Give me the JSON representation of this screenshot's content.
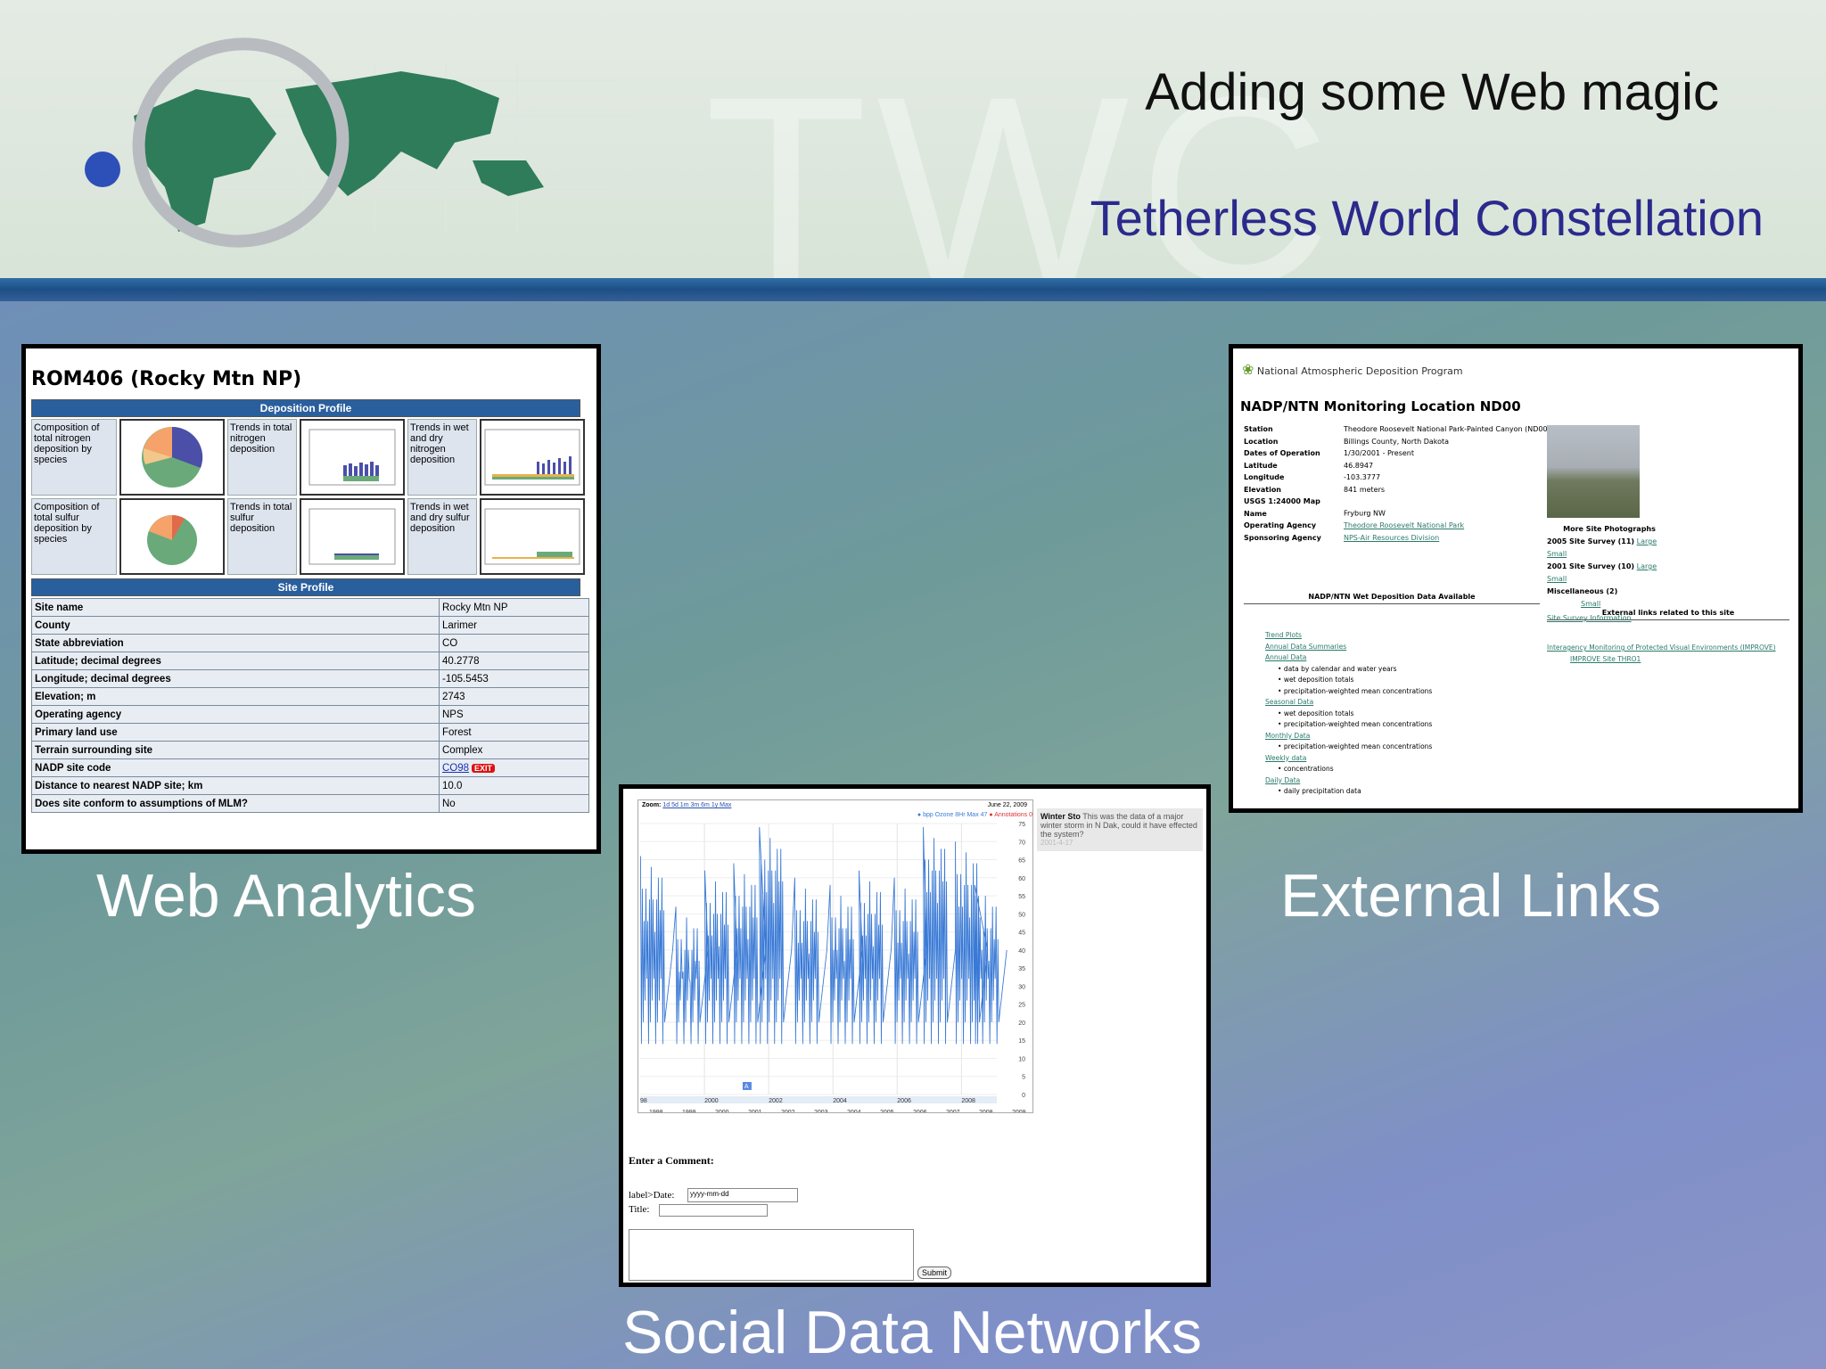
{
  "slide": {
    "title": "Adding some Web magic",
    "subtitle": "Tetherless World Constellation",
    "watermark": "TWC",
    "captions": {
      "web_analytics": "Web Analytics",
      "external_links": "External Links",
      "social_data": "Social Data Networks"
    },
    "colors": {
      "subtitle": "#2b2a8c",
      "header_bar": "#2a5f9e",
      "caption": "#ffffff"
    }
  },
  "web_analytics": {
    "site_title": "ROM406 (Rocky Mtn NP)",
    "deposition_header": "Deposition Profile",
    "dep_rows": [
      [
        "Composition of total nitrogen deposition by species",
        "Trends in total nitrogen deposition",
        "Trends in wet and dry nitrogen deposition"
      ],
      [
        "Composition of total sulfur deposition by species",
        "Trends in total sulfur deposition",
        "Trends in wet and dry sulfur deposition"
      ]
    ],
    "site_header": "Site Profile",
    "profile": [
      [
        "Site name",
        "Rocky Mtn NP"
      ],
      [
        "County",
        "Larimer"
      ],
      [
        "State abbreviation",
        "CO"
      ],
      [
        "Latitude; decimal degrees",
        "40.2778"
      ],
      [
        "Longitude; decimal degrees",
        "-105.5453"
      ],
      [
        "Elevation; m",
        "2743"
      ],
      [
        "Operating agency",
        "NPS"
      ],
      [
        "Primary land use",
        "Forest"
      ],
      [
        "Terrain surrounding site",
        "Complex"
      ],
      [
        "NADP site code",
        "CO98"
      ],
      [
        "Distance to nearest NADP site; km",
        "10.0"
      ],
      [
        "Does site conform to assumptions of MLM?",
        "No"
      ]
    ],
    "exit_badge": "EXIT"
  },
  "external_links": {
    "program": "National Atmospheric Deposition Program",
    "title": "NADP/NTN Monitoring Location ND00",
    "info": [
      [
        "Station",
        "Theodore Roosevelt National Park-Painted Canyon (ND00)"
      ],
      [
        "Location",
        "Billings County, North Dakota"
      ],
      [
        "Dates of Operation",
        "1/30/2001 - Present"
      ],
      [
        "Latitude",
        "46.8947"
      ],
      [
        "Longitude",
        "-103.3777"
      ],
      [
        "Elevation",
        "841 meters"
      ],
      [
        "USGS 1:24000 Map Name",
        "Fryburg NW"
      ],
      [
        "Operating Agency",
        "Theodore Roosevelt National Park"
      ],
      [
        "Sponsoring Agency",
        "NPS-Air Resources Division"
      ]
    ],
    "more_photos": "More Site Photographs",
    "survey_2005": "2005 Site Survey (11)",
    "survey_2001": "2001 Site Survey (10)",
    "misc": "Miscellaneous (2)",
    "large": "Large",
    "small": "Small",
    "survey_info": "Site Survey Information",
    "wet_header": "NADP/NTN Wet Deposition Data Available",
    "ext_header": "External links related to this site",
    "wet_items": {
      "trend": "Trend Plots",
      "summaries": "Annual Data Summaries",
      "annual": "Annual Data",
      "annual_b1": "data by calendar and water years",
      "annual_b2": "wet deposition totals",
      "annual_b3": "precipitation-weighted mean concentrations",
      "seasonal": "Seasonal Data",
      "seasonal_b1": "wet deposition totals",
      "seasonal_b2": "precipitation-weighted mean concentrations",
      "monthly": "Monthly Data",
      "monthly_b1": "precipitation-weighted mean concentrations",
      "weekly": "Weekly data",
      "weekly_b1": "concentrations",
      "daily": "Daily Data",
      "daily_b1": "daily precipitation data"
    },
    "ext_items": {
      "improve": "Interagency Monitoring of Protected Visual Environments (IMPROVE)",
      "improve_site": "IMPROVE Site THRO1"
    }
  },
  "social": {
    "zoom_label": "Zoom:",
    "zoom_levels": "1d 5d 1m 3m 6m 1y Max",
    "date": "June 22, 2009",
    "legend_series": "bpp Ozone 8Hr Max 47",
    "legend_annotations": "Annotations 0",
    "annotation_marker": "A",
    "annotation_title": "Winter Sto",
    "annotation_text": "This was the data of a major winter storm in N Dak, could it have effected the system?",
    "annotation_date": "2001-4-17",
    "comment_label": "Enter a Comment:",
    "date_label": "label>Date:",
    "date_placeholder": "yyyy-mm-dd",
    "title_label": "Title:",
    "submit": "Submit"
  },
  "chart_data": {
    "type": "line",
    "title": "",
    "series": [
      {
        "name": "bpp Ozone 8Hr Max"
      }
    ],
    "y_ticks": [
      "0",
      "5",
      "10",
      "15",
      "20",
      "25",
      "30",
      "35",
      "40",
      "45",
      "50",
      "55",
      "60",
      "65",
      "70",
      "75"
    ],
    "ylim": [
      0,
      75
    ],
    "x_ticks_upper": [
      "98",
      "2000",
      "2002",
      "2004",
      "2006",
      "2008"
    ],
    "x_ticks_lower": [
      "1998",
      "1999",
      "2000",
      "2001",
      "2002",
      "2003",
      "2004",
      "2005",
      "2006",
      "2007",
      "2008",
      "2009"
    ],
    "seasonal_peaks": [
      {
        "x": 1998.4,
        "y": 66
      },
      {
        "x": 1999.5,
        "y": 52
      },
      {
        "x": 2000.4,
        "y": 62
      },
      {
        "x": 2001.3,
        "y": 64
      },
      {
        "x": 2002.1,
        "y": 74
      },
      {
        "x": 2003.2,
        "y": 60
      },
      {
        "x": 2004.3,
        "y": 58
      },
      {
        "x": 2005.2,
        "y": 62
      },
      {
        "x": 2006.3,
        "y": 60
      },
      {
        "x": 2007.2,
        "y": 74
      },
      {
        "x": 2008.2,
        "y": 70
      },
      {
        "x": 2008.8,
        "y": 58
      }
    ],
    "grid": true
  }
}
